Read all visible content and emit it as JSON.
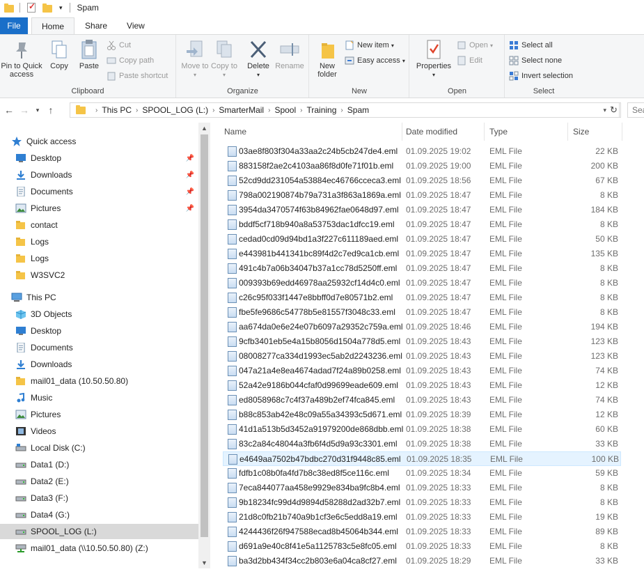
{
  "window": {
    "title": "Spam"
  },
  "tabs": [
    {
      "label": "File"
    },
    {
      "label": "Home"
    },
    {
      "label": "Share"
    },
    {
      "label": "View"
    }
  ],
  "ribbon": {
    "clipboard": {
      "label": "Clipboard",
      "pin": "Pin to Quick access",
      "copy": "Copy",
      "paste": "Paste",
      "cut": "Cut",
      "copy_path": "Copy path",
      "paste_shortcut": "Paste shortcut"
    },
    "organize": {
      "label": "Organize",
      "move_to": "Move to",
      "copy_to": "Copy to",
      "delete": "Delete",
      "rename": "Rename"
    },
    "new": {
      "label": "New",
      "new_folder": "New folder",
      "new_item": "New item",
      "easy_access": "Easy access"
    },
    "open": {
      "label": "Open",
      "properties": "Properties",
      "open": "Open",
      "edit": "Edit"
    },
    "select": {
      "label": "Select",
      "select_all": "Select all",
      "select_none": "Select none",
      "invert": "Invert selection"
    }
  },
  "address": {
    "crumbs": [
      "This PC",
      "SPOOL_LOG (L:)",
      "SmarterMail",
      "Spool",
      "Training",
      "Spam"
    ],
    "search_placeholder": "Sea"
  },
  "nav": {
    "quick_access": "Quick access",
    "quick_items": [
      {
        "label": "Desktop",
        "icon": "desktop-icon",
        "pinned": true
      },
      {
        "label": "Downloads",
        "icon": "download-icon",
        "pinned": true
      },
      {
        "label": "Documents",
        "icon": "documents-icon",
        "pinned": true
      },
      {
        "label": "Pictures",
        "icon": "pictures-icon",
        "pinned": true
      },
      {
        "label": "contact",
        "icon": "folder-icon",
        "pinned": false
      },
      {
        "label": "Logs",
        "icon": "folder-icon",
        "pinned": false
      },
      {
        "label": "Logs",
        "icon": "folder-icon",
        "pinned": false
      },
      {
        "label": "W3SVC2",
        "icon": "folder-icon",
        "pinned": false
      }
    ],
    "this_pc": "This PC",
    "pc_items": [
      {
        "label": "3D Objects",
        "icon": "3d-objects-icon"
      },
      {
        "label": "Desktop",
        "icon": "desktop-icon"
      },
      {
        "label": "Documents",
        "icon": "documents-icon"
      },
      {
        "label": "Downloads",
        "icon": "download-icon"
      },
      {
        "label": "mail01_data (10.50.50.80)",
        "icon": "folder-icon"
      },
      {
        "label": "Music",
        "icon": "music-icon"
      },
      {
        "label": "Pictures",
        "icon": "pictures-icon"
      },
      {
        "label": "Videos",
        "icon": "videos-icon"
      },
      {
        "label": "Local Disk (C:)",
        "icon": "local-disk-icon"
      },
      {
        "label": "Data1 (D:)",
        "icon": "drive-icon"
      },
      {
        "label": "Data2 (E:)",
        "icon": "drive-icon"
      },
      {
        "label": "Data3 (F:)",
        "icon": "drive-icon"
      },
      {
        "label": "Data4 (G:)",
        "icon": "drive-icon"
      },
      {
        "label": "SPOOL_LOG (L:)",
        "icon": "drive-icon",
        "selected": true
      },
      {
        "label": "mail01_data (\\\\10.50.50.80) (Z:)",
        "icon": "network-drive-icon"
      }
    ]
  },
  "columns": {
    "name": "Name",
    "date": "Date modified",
    "type": "Type",
    "size": "Size"
  },
  "files": [
    {
      "name": "03ae8f803f304a33aa2c24b5cb247de4.eml",
      "date": "01.09.2025 19:02",
      "type": "EML File",
      "size": "22 KB"
    },
    {
      "name": "883158f2ae2c4103aa86f8d0fe71f01b.eml",
      "date": "01.09.2025 19:00",
      "type": "EML File",
      "size": "200 KB"
    },
    {
      "name": "52cd9dd231054a53884ec46766cceca3.eml",
      "date": "01.09.2025 18:56",
      "type": "EML File",
      "size": "67 KB"
    },
    {
      "name": "798a002190874b79a731a3f863a1869a.eml",
      "date": "01.09.2025 18:47",
      "type": "EML File",
      "size": "8 KB"
    },
    {
      "name": "3954da3470574f63b84962fae0648d97.eml",
      "date": "01.09.2025 18:47",
      "type": "EML File",
      "size": "184 KB"
    },
    {
      "name": "bddf5cf718b940a8a53753dac1dfcc19.eml",
      "date": "01.09.2025 18:47",
      "type": "EML File",
      "size": "8 KB"
    },
    {
      "name": "cedad0cd09d94bd1a3f227c611189aed.eml",
      "date": "01.09.2025 18:47",
      "type": "EML File",
      "size": "50 KB"
    },
    {
      "name": "e443981b441341bc89f4d2c7ed9ca1cb.eml",
      "date": "01.09.2025 18:47",
      "type": "EML File",
      "size": "135 KB"
    },
    {
      "name": "491c4b7a06b34047b37a1cc78d5250ff.eml",
      "date": "01.09.2025 18:47",
      "type": "EML File",
      "size": "8 KB"
    },
    {
      "name": "009393b69edd46978aa25932cf14d4c0.eml",
      "date": "01.09.2025 18:47",
      "type": "EML File",
      "size": "8 KB"
    },
    {
      "name": "c26c95f033f1447e8bbff0d7e80571b2.eml",
      "date": "01.09.2025 18:47",
      "type": "EML File",
      "size": "8 KB"
    },
    {
      "name": "fbe5fe9686c54778b5e81557f3048c33.eml",
      "date": "01.09.2025 18:47",
      "type": "EML File",
      "size": "8 KB"
    },
    {
      "name": "aa674da0e6e24e07b6097a29352c759a.eml",
      "date": "01.09.2025 18:46",
      "type": "EML File",
      "size": "194 KB"
    },
    {
      "name": "9cfb3401eb5e4a15b8056d1504a778d5.eml",
      "date": "01.09.2025 18:43",
      "type": "EML File",
      "size": "123 KB"
    },
    {
      "name": "08008277ca334d1993ec5ab2d2243236.eml",
      "date": "01.09.2025 18:43",
      "type": "EML File",
      "size": "123 KB"
    },
    {
      "name": "047a21a4e8ea4674adad7f24a89b0258.eml",
      "date": "01.09.2025 18:43",
      "type": "EML File",
      "size": "74 KB"
    },
    {
      "name": "52a42e9186b044cfaf0d99699eade609.eml",
      "date": "01.09.2025 18:43",
      "type": "EML File",
      "size": "12 KB"
    },
    {
      "name": "ed8058968c7c4f37a489b2ef74fca845.eml",
      "date": "01.09.2025 18:43",
      "type": "EML File",
      "size": "74 KB"
    },
    {
      "name": "b88c853ab42e48c09a55a34393c5d671.eml",
      "date": "01.09.2025 18:39",
      "type": "EML File",
      "size": "12 KB"
    },
    {
      "name": "41d1a513b5d3452a91979200de868dbb.eml",
      "date": "01.09.2025 18:38",
      "type": "EML File",
      "size": "60 KB"
    },
    {
      "name": "83c2a84c48044a3fb6f4d5d9a93c3301.eml",
      "date": "01.09.2025 18:38",
      "type": "EML File",
      "size": "33 KB"
    },
    {
      "name": "e4649aa7502b47bdbc270d31f9448c85.eml",
      "date": "01.09.2025 18:35",
      "type": "EML File",
      "size": "100 KB",
      "hover": true
    },
    {
      "name": "fdfb1c08b0fa4fd7b8c38ed8f5ce116c.eml",
      "date": "01.09.2025 18:34",
      "type": "EML File",
      "size": "59 KB"
    },
    {
      "name": "7eca844077aa458e9929e834ba9fc8b4.eml",
      "date": "01.09.2025 18:33",
      "type": "EML File",
      "size": "8 KB"
    },
    {
      "name": "9b18234fc99d4d9894d58288d2ad32b7.eml",
      "date": "01.09.2025 18:33",
      "type": "EML File",
      "size": "8 KB"
    },
    {
      "name": "21d8c0fb21b740a9b1cf3e6c5edd8a19.eml",
      "date": "01.09.2025 18:33",
      "type": "EML File",
      "size": "19 KB"
    },
    {
      "name": "4244436f26f947588ecad8b45064b344.eml",
      "date": "01.09.2025 18:33",
      "type": "EML File",
      "size": "89 KB"
    },
    {
      "name": "d691a9e40c8f41e5a1125783c5e8fc05.eml",
      "date": "01.09.2025 18:33",
      "type": "EML File",
      "size": "8 KB"
    },
    {
      "name": "ba3d2bb434f34cc2b803e6a04ca8cf27.eml",
      "date": "01.09.2025 18:29",
      "type": "EML File",
      "size": "33 KB"
    }
  ],
  "colors": {
    "file_tab": "#1a6fc9",
    "selection": "#d9d9d9",
    "hover_row": "#e5f3ff",
    "folder": "#f5c447"
  }
}
